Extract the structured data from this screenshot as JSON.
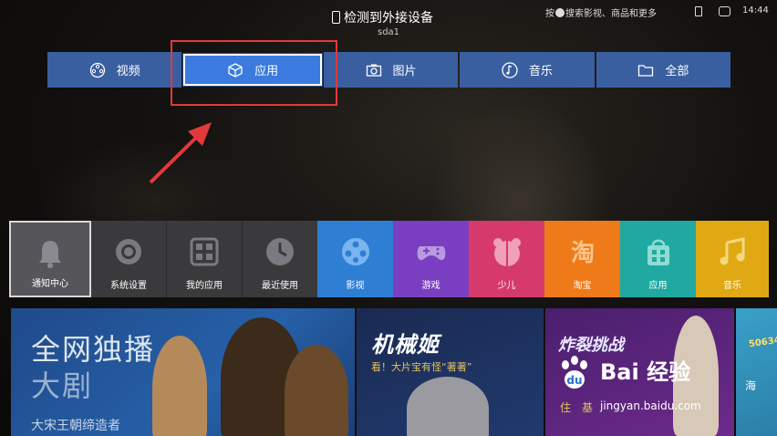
{
  "topbar": {
    "title": "检测到外接设备",
    "subtitle": "sda1",
    "hint_prefix": "按",
    "hint_suffix": "搜索影视、商品和更多",
    "time": "14:44"
  },
  "tabs": [
    {
      "label": "视频",
      "icon": "film-reel-icon",
      "active": false
    },
    {
      "label": "应用",
      "icon": "cube-icon",
      "active": true
    },
    {
      "label": "图片",
      "icon": "camera-icon",
      "active": false
    },
    {
      "label": "音乐",
      "icon": "music-note-icon",
      "active": false
    },
    {
      "label": "全部",
      "icon": "folder-icon",
      "active": false
    }
  ],
  "apps": [
    {
      "label": "通知中心",
      "icon": "bell-icon",
      "color": "#55555a",
      "focused": true
    },
    {
      "label": "系统设置",
      "icon": "gear-icon",
      "color": "#3a3a3c"
    },
    {
      "label": "我的应用",
      "icon": "grid-icon",
      "color": "#3a3a3c"
    },
    {
      "label": "最近使用",
      "icon": "clock-icon",
      "color": "#3a3a3c"
    },
    {
      "label": "影视",
      "icon": "film-reel-icon",
      "color": "#2e7fd4"
    },
    {
      "label": "游戏",
      "icon": "gamepad-icon",
      "color": "#7a3fc0"
    },
    {
      "label": "少儿",
      "icon": "kid-face-icon",
      "color": "#d63a6a"
    },
    {
      "label": "淘宝",
      "icon": "taobao-icon",
      "color": "#ef7a1a"
    },
    {
      "label": "应用",
      "icon": "shopping-bag-icon",
      "color": "#1fa9a0"
    },
    {
      "label": "音乐",
      "icon": "music-note-icon",
      "color": "#e0a812"
    }
  ],
  "banners": {
    "b1_title": "全网独播",
    "b1_sub": "大剧",
    "b1_small": "大宋王朝缔造者",
    "b2_title": "机械姬",
    "b2_sub": "看！大片宝有怪“著著”",
    "b3_title": "炸裂挑战",
    "b3_small": "住　基",
    "b4_logo": "50634",
    "b4_text": "海"
  },
  "watermark": {
    "main": "Bai 经验",
    "url": "jingyan.baidu.com"
  },
  "colors": {
    "tab_bg": "#3a5fa0",
    "tab_active": "#3b7be0",
    "annotation_red": "#e23a3a"
  }
}
